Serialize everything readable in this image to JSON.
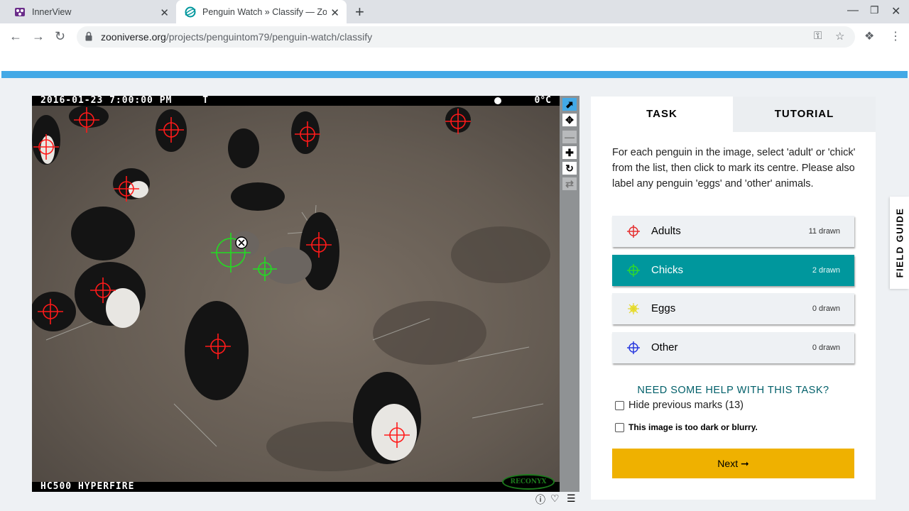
{
  "browser": {
    "tabs": [
      {
        "title": "InnerView"
      },
      {
        "title": "Penguin Watch » Classify — Zoon"
      }
    ],
    "url_host": "zooniverse.org",
    "url_path": "/projects/penguintom79/penguin-watch/classify",
    "close_glyph": "✕",
    "new_tab_glyph": "+"
  },
  "viewer": {
    "timestamp": "2016-01-23 7:00:00 PM",
    "flag": "T",
    "temperature": "0°C",
    "camera_model": "HC500 HYPERFIRE",
    "brand": "RECONYX",
    "tools": [
      "pointer",
      "pan",
      "zoom-out",
      "zoom-in",
      "rotate",
      "reset"
    ],
    "active_tool": "pointer",
    "marks": {
      "adults": 11,
      "chicks": 2,
      "adult_color": "#ff1a1a",
      "chick_color": "#22dd22"
    }
  },
  "panel": {
    "tab_task": "TASK",
    "tab_tutorial": "TUTORIAL",
    "instructions": "For each penguin in the image, select 'adult' or 'chick' from the list, then click to mark its centre. Please also label any penguin 'eggs' and 'other' animals.",
    "options": [
      {
        "label": "Adults",
        "count": "11 drawn",
        "color": "#e53030",
        "selected": false
      },
      {
        "label": "Chicks",
        "count": "2 drawn",
        "color": "#2ed82e",
        "selected": true
      },
      {
        "label": "Eggs",
        "count": "0 drawn",
        "color": "#e8e030",
        "selected": false
      },
      {
        "label": "Other",
        "count": "0 drawn",
        "color": "#2a3adf",
        "selected": false
      }
    ],
    "help": "NEED SOME HELP WITH THIS TASK?",
    "hide_marks": "Hide previous marks (13)",
    "too_dark": "This image is too dark or blurry.",
    "next_label": "Next ➞",
    "accent_color": "#00979d",
    "next_color": "#efb100"
  },
  "field_guide": "FIELD GUIDE"
}
